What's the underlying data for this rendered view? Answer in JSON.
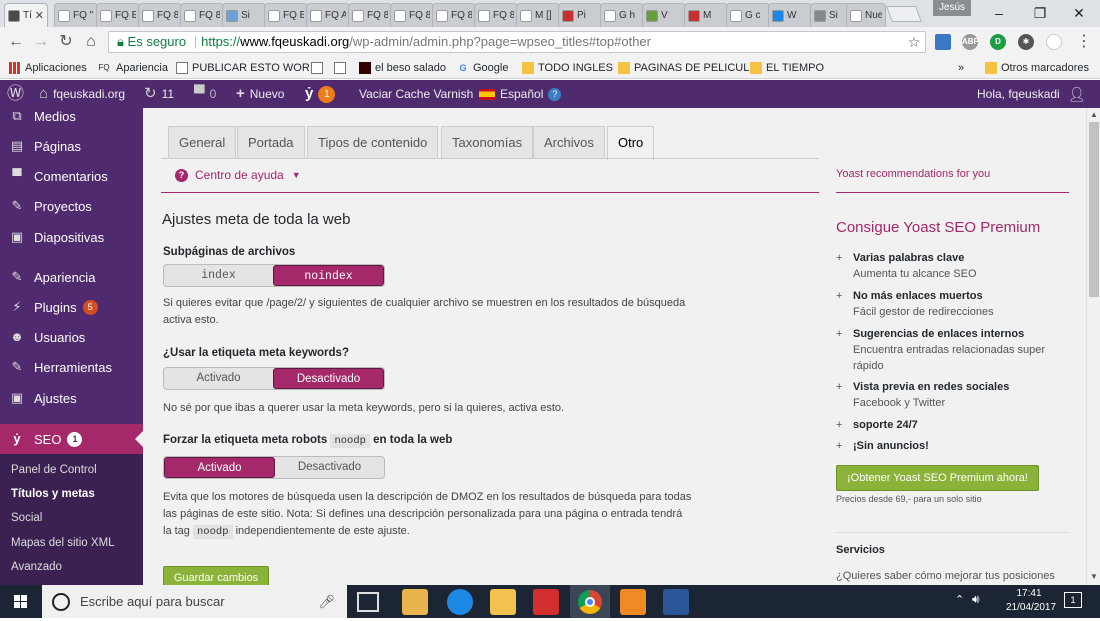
{
  "browser": {
    "tabs": [
      {
        "label": "Tí",
        "fav": "wp",
        "color": "#ffffff"
      },
      {
        "label": "FQ \"",
        "fav": "fq",
        "color": "#ffffff"
      },
      {
        "label": "FQ Ei",
        "fav": "fq",
        "color": "#ffffff"
      },
      {
        "label": "FQ 8",
        "fav": "fq",
        "color": "#ffffff"
      },
      {
        "label": "FQ 8",
        "fav": "fq",
        "color": "#ffffff"
      },
      {
        "label": "Si",
        "fav": "doc",
        "color": "#ffffff"
      },
      {
        "label": "FQ B",
        "fav": "fq",
        "color": "#ffffff"
      },
      {
        "label": "FQ A",
        "fav": "fq",
        "color": "#ffffff"
      },
      {
        "label": "FQ 8",
        "fav": "fq",
        "color": "#ffffff"
      },
      {
        "label": "FQ 8",
        "fav": "fq",
        "color": "#ffffff"
      },
      {
        "label": "FQ 8",
        "fav": "fq",
        "color": "#ffffff"
      },
      {
        "label": "FQ 8",
        "fav": "fq",
        "color": "#ffffff"
      },
      {
        "label": "M []",
        "fav": "gmail",
        "color": "#d93025"
      },
      {
        "label": "Pi",
        "fav": "w",
        "color": "#c9302c"
      },
      {
        "label": "G h",
        "fav": "g",
        "color": "#4285f4"
      },
      {
        "label": "V",
        "fav": "apk",
        "color": "#689f38"
      },
      {
        "label": "M",
        "fav": "w",
        "color": "#c9302c"
      },
      {
        "label": "G c",
        "fav": "g",
        "color": "#4285f4"
      },
      {
        "label": "W",
        "fav": "img",
        "color": "#1e88e5"
      },
      {
        "label": "Si",
        "fav": "user",
        "color": "#555555"
      },
      {
        "label": "Nuev",
        "fav": "blank",
        "color": "#ffffff"
      }
    ],
    "user_chip": "Jesús",
    "window_buttons": [
      "–",
      "❐",
      "✕"
    ],
    "secure_label": "Es seguro",
    "url_scheme": "https://",
    "url_host": "www.fqeuskadi.org",
    "url_path": "/wp-admin/admin.php?page=wpseo_titles#top#other",
    "bookmarks": [
      {
        "label": "Aplicaciones",
        "icon": "apps-icon"
      },
      {
        "label": "Apariencia",
        "icon": "fq-icon"
      },
      {
        "label": "PUBLICAR ESTO WOR",
        "icon": "page-icon"
      },
      {
        "label": "",
        "icon": "page-icon"
      },
      {
        "label": "",
        "icon": "page-icon"
      },
      {
        "label": "el beso salado",
        "icon": "dark-icon"
      },
      {
        "label": "Google",
        "icon": "google-icon"
      },
      {
        "label": "TODO INGLES",
        "icon": "folder-icon"
      },
      {
        "label": "PAGINAS DE PELICUL",
        "icon": "folder-icon"
      },
      {
        "label": "EL TIEMPO",
        "icon": "folder-icon"
      }
    ],
    "bookmarks_overflow": "»",
    "other_bookmarks": "Otros marcadores"
  },
  "adminbar": {
    "site": "fqeuskadi.org",
    "updates": "11",
    "comments": "0",
    "new": "Nuevo",
    "yoast_badge": "1",
    "varnish": "Vaciar Cache Varnish",
    "language": "Español",
    "greeting": "Hola, fqeuskadi"
  },
  "menu": {
    "items": [
      {
        "label": "Medios",
        "icon": "media-icon"
      },
      {
        "label": "Páginas",
        "icon": "pages-icon"
      },
      {
        "label": "Comentarios",
        "icon": "comments-icon"
      },
      {
        "label": "Proyectos",
        "icon": "pin-icon"
      },
      {
        "label": "Diapositivas",
        "icon": "slides-icon"
      },
      {
        "label": "Apariencia",
        "icon": "brush-icon"
      },
      {
        "label": "Plugins",
        "icon": "plugin-icon"
      },
      {
        "label": "Usuarios",
        "icon": "users-icon"
      },
      {
        "label": "Herramientas",
        "icon": "tools-icon"
      },
      {
        "label": "Ajustes",
        "icon": "settings-icon"
      }
    ],
    "plugins_count": "5",
    "seo_label": "SEO",
    "seo_count": "1",
    "submenu": [
      "Panel de Control",
      "Títulos y metas",
      "Social",
      "Mapas del sitio XML",
      "Avanzado"
    ]
  },
  "tabs": [
    "General",
    "Portada",
    "Tipos de contenido",
    "Taxonomías",
    "Archivos",
    "Otro"
  ],
  "help_label": "Centro de ayuda",
  "section_title": "Ajustes meta de toda la web",
  "settings": {
    "subpages": {
      "label": "Subpáginas de archivos",
      "off": "index",
      "on": "noindex",
      "desc": "Si quieres evitar que /page/2/ y siguientes de cualquier archivo se muestren en los resultados de búsqueda activa esto."
    },
    "keywords": {
      "label": "¿Usar la etiqueta meta keywords?",
      "a": "Activado",
      "b": "Desactivado",
      "desc": "No sé por que ibas a querer usar la meta keywords, pero si la quieres, activa esto."
    },
    "noodp": {
      "label_pre": "Forzar la etiqueta meta robots",
      "code": "noodp",
      "label_post": "en toda la web",
      "a": "Activado",
      "b": "Desactivado",
      "desc_1": "Evita que los motores de búsqueda usen la descripción de DMOZ en los resultados de búsqueda para todas las páginas de este sitio. Nota: Si defines una descripción personalizada para una página o entrada tendrá la tag",
      "desc_code": "noodp",
      "desc_2": "independientemente de este ajuste."
    }
  },
  "save_label": "Guardar cambios",
  "sidebar": {
    "recommendations": "Yoast recommendations for you",
    "premium_title": "Consigue Yoast SEO Premium",
    "features": [
      {
        "title": "Varias palabras clave",
        "desc": "Aumenta tu alcance SEO"
      },
      {
        "title": "No más enlaces muertos",
        "desc": "Fácil gestor de redirecciones"
      },
      {
        "title": "Sugerencias de enlaces internos",
        "desc": "Encuentra entradas relacionadas super rápido"
      },
      {
        "title": "Vista previa en redes sociales",
        "desc": "Facebook y Twitter"
      },
      {
        "title": "soporte 24/7",
        "desc": ""
      },
      {
        "title": "¡Sin anuncios!",
        "desc": ""
      }
    ],
    "cta": "¡Obtener Yoast SEO Premium ahora!",
    "price": "Precios desde 69,- para un solo sitio",
    "services": "Servicios",
    "services_q": "¿Quieres saber cómo mejorar tus posiciones"
  },
  "taskbar": {
    "search_placeholder": "Escribe aquí para buscar",
    "time": "17:41",
    "date": "21/04/2017",
    "notifications": "1"
  },
  "colors": {
    "purple": "#4f2a6e",
    "magenta": "#a4286a",
    "green": "#8bb33a"
  }
}
